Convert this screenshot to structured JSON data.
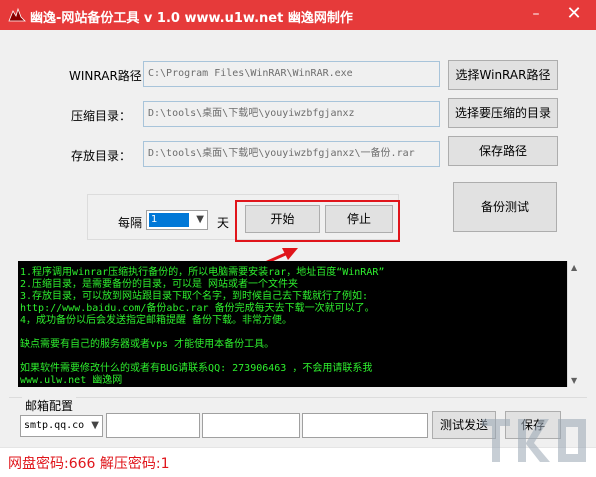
{
  "window": {
    "title": "幽逸-网站备份工具 v 1.0 www.u1w.net 幽逸网制作",
    "minimize_glyph": "–",
    "close_glyph": "✕"
  },
  "winrar": {
    "label": "WINRAR路径：",
    "value": "C:\\Program Files\\WinRAR\\WinRAR.exe",
    "button": "选择WinRAR路径"
  },
  "compress_dir": {
    "label": "压缩目录：",
    "value": "D:\\tools\\桌面\\下载吧\\youyiwzbfgjanxz",
    "button": "选择要压缩的目录"
  },
  "save_dir": {
    "label": "存放目录：",
    "value": "D:\\tools\\桌面\\下载吧\\youyiwzbfgjanxz\\一备份.rar",
    "button": "保存路径"
  },
  "schedule": {
    "every_label": "每隔",
    "interval_value": "1",
    "unit_label": "天",
    "start_button": "开始",
    "stop_button": "停止",
    "test_button": "备份测试"
  },
  "console": {
    "lines": [
      "1.程序调用winrar压缩执行备份的，所以电脑需要安装rar，地址百度“WinRAR”",
      "2.压缩目录，是需要备份的目录，可以是 网站或者一个文件夹",
      "3.存放目录，可以放到网站跟目录下取个名字，到时候自己去下载就行了例如:",
      "http://www.baidu.com/备份abc.rar 备份完成每天去下载一次就可以了。",
      "4，成功备份以后会发送指定邮箱提醒 备份下载。非常方便。",
      "",
      " 缺点需要有自己的服务器或者vps 才能使用本备份工具。",
      "",
      "如果软件需要修改什么的或者有BUG请联系QQ: 273906463 ，不会用请联系我",
      "www.ulw.net 幽逸网"
    ]
  },
  "mail": {
    "section_label": "邮箱配置",
    "smtp_value": "smtp.qq.co",
    "test_button": "测试发送",
    "extra_button": "保存"
  },
  "status": {
    "text": "网盘密码:666 解压密码:1"
  },
  "colors": {
    "title_bar": "#e63a3a",
    "highlight": "#e0151b",
    "console_bg": "#000000",
    "console_text": "#2ef02e"
  }
}
